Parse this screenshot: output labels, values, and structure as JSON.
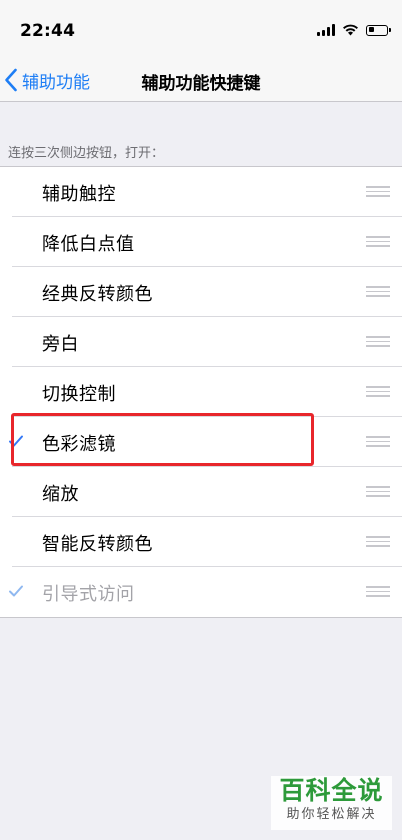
{
  "status_bar": {
    "time": "22:44",
    "battery_level": 0.35
  },
  "nav": {
    "back_label": "辅助功能",
    "title": "辅助功能快捷键"
  },
  "section": {
    "header": "连按三次侧边按钮，打开："
  },
  "items": [
    {
      "label": "辅助触控",
      "checked": false,
      "disabled": false
    },
    {
      "label": "降低白点值",
      "checked": false,
      "disabled": false
    },
    {
      "label": "经典反转颜色",
      "checked": false,
      "disabled": false
    },
    {
      "label": "旁白",
      "checked": false,
      "disabled": false
    },
    {
      "label": "切换控制",
      "checked": false,
      "disabled": false
    },
    {
      "label": "色彩滤镜",
      "checked": true,
      "disabled": false
    },
    {
      "label": "缩放",
      "checked": false,
      "disabled": false
    },
    {
      "label": "智能反转颜色",
      "checked": false,
      "disabled": false
    },
    {
      "label": "引导式访问",
      "checked": true,
      "disabled": true
    }
  ],
  "colors": {
    "accent": "#1e7ef5",
    "check_active": "#3478f6",
    "check_disabled": "#8fb8f0",
    "highlight": "#e8262b",
    "watermark": "#2d9a3a"
  },
  "watermark": {
    "title": "百科全说",
    "subtitle": "助你轻松解决"
  }
}
